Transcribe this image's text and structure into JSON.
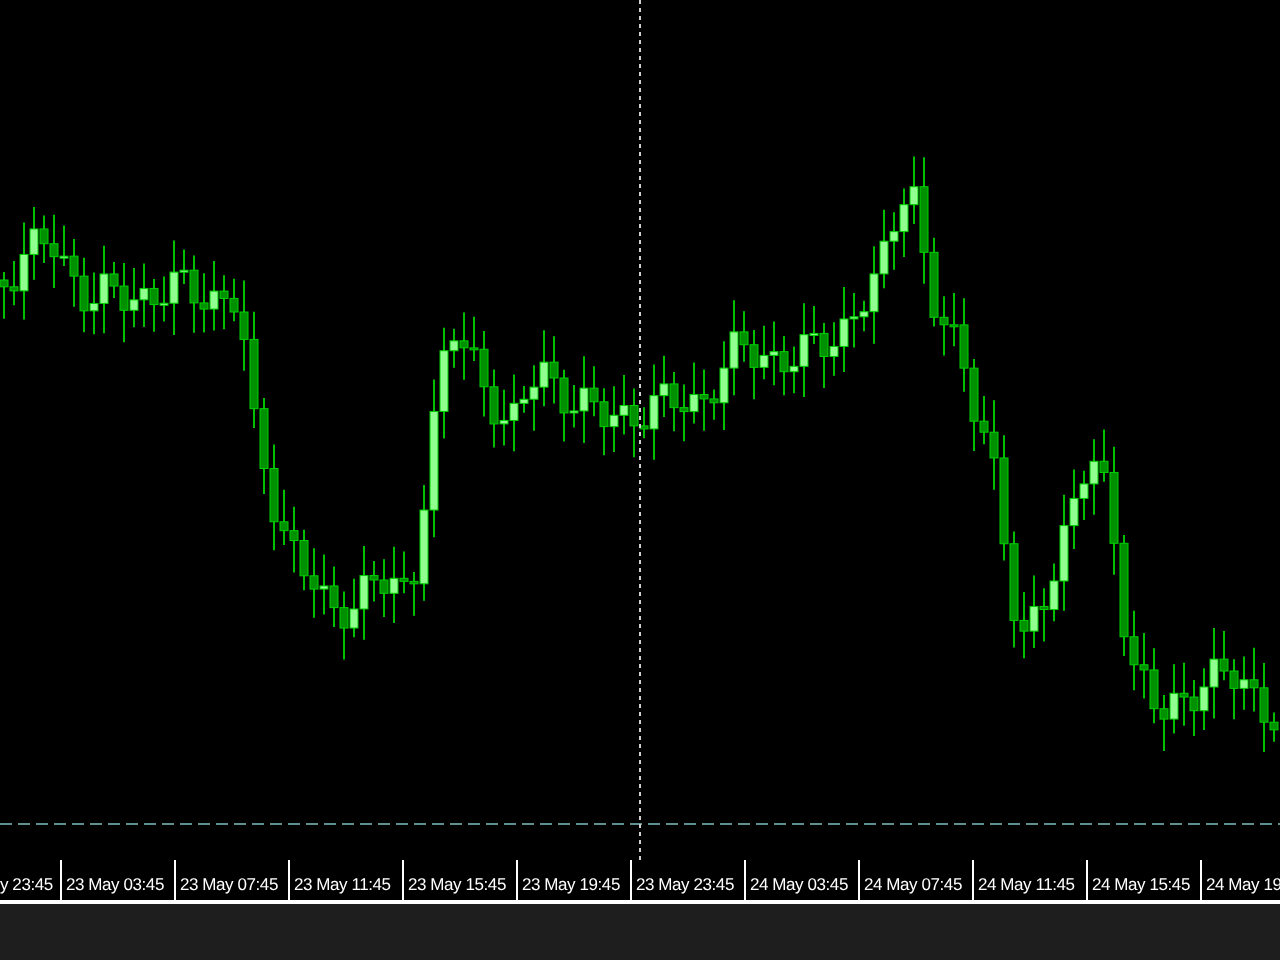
{
  "x_axis": {
    "labels": [
      "y 23:45",
      "23 May 03:45",
      "23 May 07:45",
      "23 May 11:45",
      "23 May 15:45",
      "23 May 19:45",
      "23 May 23:45",
      "24 May 03:45",
      "24 May 07:45",
      "24 May 11:45",
      "24 May 15:45",
      "24 May 19"
    ]
  }
}
